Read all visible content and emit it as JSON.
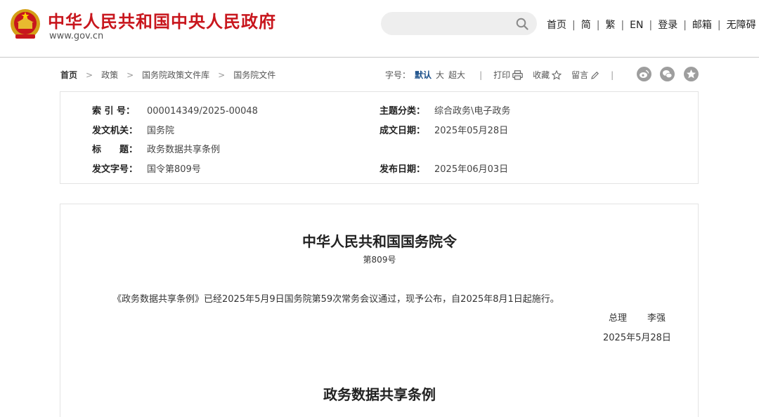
{
  "header": {
    "site_title": "中华人民共和国中央人民政府",
    "site_domain": "www.gov.cn",
    "search_placeholder": "",
    "nav": [
      "首页",
      "简",
      "繁",
      "EN",
      "登录",
      "邮箱",
      "无障碍"
    ],
    "separator": "|",
    "brand_color": "#c8161d"
  },
  "breadcrumb": {
    "items": [
      "首页",
      "政策",
      "国务院政策文件库",
      "国务院文件"
    ],
    "arrow": ">"
  },
  "toolbar": {
    "font_label": "字号：",
    "font_default": "默认",
    "font_large": "大",
    "font_xlarge": "超大",
    "divider": "|",
    "print_label": "打印",
    "fav_label": "收藏",
    "comment_label": "留言",
    "share_icons": [
      "weibo-icon",
      "wechat-icon",
      "qzone-icon"
    ]
  },
  "info": {
    "index_label": "索 引 号：",
    "index_value": "000014349/2025-00048",
    "topic_label": "主题分类：",
    "topic_value": "综合政务\\电子政务",
    "issuer_label": "发文机关：",
    "issuer_value": "国务院",
    "written_label": "成文日期：",
    "written_value": "2025年05月28日",
    "title_label": "标　　题：",
    "title_value": "政务数据共享条例",
    "docno_label": "发文字号：",
    "docno_value": "国令第809号",
    "publish_label": "发布日期：",
    "publish_value": "2025年06月03日"
  },
  "document": {
    "title": "中华人民共和国国务院令",
    "number": "第809号",
    "body": "《政务数据共享条例》已经2025年5月9日国务院第59次常务会议通过，现予公布，自2025年8月1日起施行。",
    "sign_title": "总理",
    "sign_name": "李强",
    "sign_date": "2025年5月28日",
    "article_title": "政务数据共享条例"
  }
}
